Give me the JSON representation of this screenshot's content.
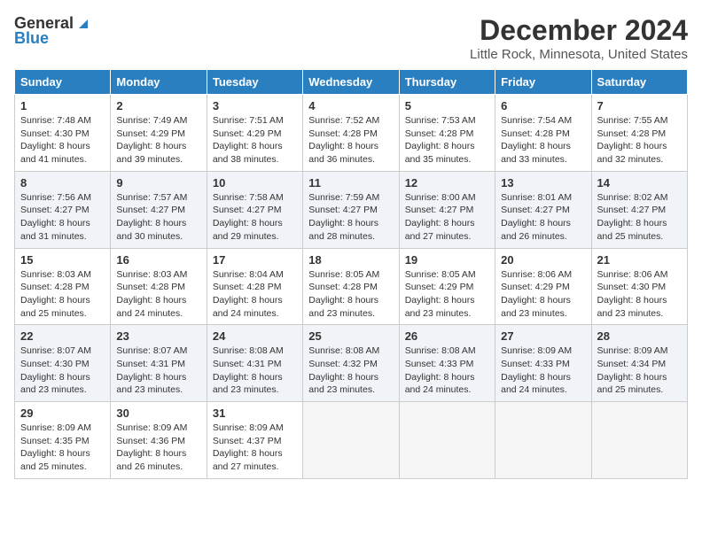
{
  "logo": {
    "general": "General",
    "blue": "Blue"
  },
  "title": {
    "month": "December 2024",
    "location": "Little Rock, Minnesota, United States"
  },
  "headers": [
    "Sunday",
    "Monday",
    "Tuesday",
    "Wednesday",
    "Thursday",
    "Friday",
    "Saturday"
  ],
  "weeks": [
    [
      {
        "day": "1",
        "sunrise": "7:48 AM",
        "sunset": "4:30 PM",
        "daylight": "8 hours and 41 minutes."
      },
      {
        "day": "2",
        "sunrise": "7:49 AM",
        "sunset": "4:29 PM",
        "daylight": "8 hours and 39 minutes."
      },
      {
        "day": "3",
        "sunrise": "7:51 AM",
        "sunset": "4:29 PM",
        "daylight": "8 hours and 38 minutes."
      },
      {
        "day": "4",
        "sunrise": "7:52 AM",
        "sunset": "4:28 PM",
        "daylight": "8 hours and 36 minutes."
      },
      {
        "day": "5",
        "sunrise": "7:53 AM",
        "sunset": "4:28 PM",
        "daylight": "8 hours and 35 minutes."
      },
      {
        "day": "6",
        "sunrise": "7:54 AM",
        "sunset": "4:28 PM",
        "daylight": "8 hours and 33 minutes."
      },
      {
        "day": "7",
        "sunrise": "7:55 AM",
        "sunset": "4:28 PM",
        "daylight": "8 hours and 32 minutes."
      }
    ],
    [
      {
        "day": "8",
        "sunrise": "7:56 AM",
        "sunset": "4:27 PM",
        "daylight": "8 hours and 31 minutes."
      },
      {
        "day": "9",
        "sunrise": "7:57 AM",
        "sunset": "4:27 PM",
        "daylight": "8 hours and 30 minutes."
      },
      {
        "day": "10",
        "sunrise": "7:58 AM",
        "sunset": "4:27 PM",
        "daylight": "8 hours and 29 minutes."
      },
      {
        "day": "11",
        "sunrise": "7:59 AM",
        "sunset": "4:27 PM",
        "daylight": "8 hours and 28 minutes."
      },
      {
        "day": "12",
        "sunrise": "8:00 AM",
        "sunset": "4:27 PM",
        "daylight": "8 hours and 27 minutes."
      },
      {
        "day": "13",
        "sunrise": "8:01 AM",
        "sunset": "4:27 PM",
        "daylight": "8 hours and 26 minutes."
      },
      {
        "day": "14",
        "sunrise": "8:02 AM",
        "sunset": "4:27 PM",
        "daylight": "8 hours and 25 minutes."
      }
    ],
    [
      {
        "day": "15",
        "sunrise": "8:03 AM",
        "sunset": "4:28 PM",
        "daylight": "8 hours and 25 minutes."
      },
      {
        "day": "16",
        "sunrise": "8:03 AM",
        "sunset": "4:28 PM",
        "daylight": "8 hours and 24 minutes."
      },
      {
        "day": "17",
        "sunrise": "8:04 AM",
        "sunset": "4:28 PM",
        "daylight": "8 hours and 24 minutes."
      },
      {
        "day": "18",
        "sunrise": "8:05 AM",
        "sunset": "4:28 PM",
        "daylight": "8 hours and 23 minutes."
      },
      {
        "day": "19",
        "sunrise": "8:05 AM",
        "sunset": "4:29 PM",
        "daylight": "8 hours and 23 minutes."
      },
      {
        "day": "20",
        "sunrise": "8:06 AM",
        "sunset": "4:29 PM",
        "daylight": "8 hours and 23 minutes."
      },
      {
        "day": "21",
        "sunrise": "8:06 AM",
        "sunset": "4:30 PM",
        "daylight": "8 hours and 23 minutes."
      }
    ],
    [
      {
        "day": "22",
        "sunrise": "8:07 AM",
        "sunset": "4:30 PM",
        "daylight": "8 hours and 23 minutes."
      },
      {
        "day": "23",
        "sunrise": "8:07 AM",
        "sunset": "4:31 PM",
        "daylight": "8 hours and 23 minutes."
      },
      {
        "day": "24",
        "sunrise": "8:08 AM",
        "sunset": "4:31 PM",
        "daylight": "8 hours and 23 minutes."
      },
      {
        "day": "25",
        "sunrise": "8:08 AM",
        "sunset": "4:32 PM",
        "daylight": "8 hours and 23 minutes."
      },
      {
        "day": "26",
        "sunrise": "8:08 AM",
        "sunset": "4:33 PM",
        "daylight": "8 hours and 24 minutes."
      },
      {
        "day": "27",
        "sunrise": "8:09 AM",
        "sunset": "4:33 PM",
        "daylight": "8 hours and 24 minutes."
      },
      {
        "day": "28",
        "sunrise": "8:09 AM",
        "sunset": "4:34 PM",
        "daylight": "8 hours and 25 minutes."
      }
    ],
    [
      {
        "day": "29",
        "sunrise": "8:09 AM",
        "sunset": "4:35 PM",
        "daylight": "8 hours and 25 minutes."
      },
      {
        "day": "30",
        "sunrise": "8:09 AM",
        "sunset": "4:36 PM",
        "daylight": "8 hours and 26 minutes."
      },
      {
        "day": "31",
        "sunrise": "8:09 AM",
        "sunset": "4:37 PM",
        "daylight": "8 hours and 27 minutes."
      },
      null,
      null,
      null,
      null
    ]
  ]
}
